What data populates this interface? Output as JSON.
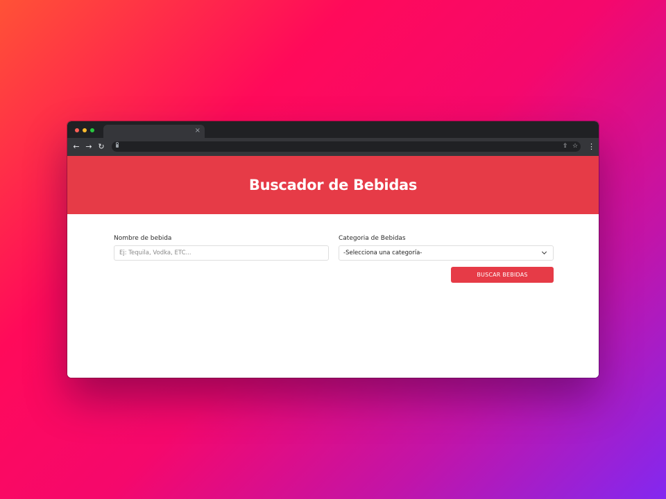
{
  "browser": {
    "tab_close_glyph": "×",
    "nav": {
      "back_glyph": "←",
      "forward_glyph": "→",
      "reload_glyph": "↻"
    },
    "omnibox": {
      "share_glyph": "⇪",
      "bookmark_glyph": "☆"
    },
    "menu_glyph": "⋮"
  },
  "page": {
    "title": "Buscador de Bebidas",
    "form": {
      "name_label": "Nombre de bebida",
      "name_placeholder": "Ej: Tequila, Vodka, ETC...",
      "category_label": "Categoria de Bebidas",
      "category_selected": "-Selecciona una categoría-",
      "submit_label": "BUSCAR BEBIDAS"
    }
  },
  "colors": {
    "accent": "#e63b47",
    "browser_chrome": "#202124",
    "browser_toolbar": "#35363a"
  }
}
